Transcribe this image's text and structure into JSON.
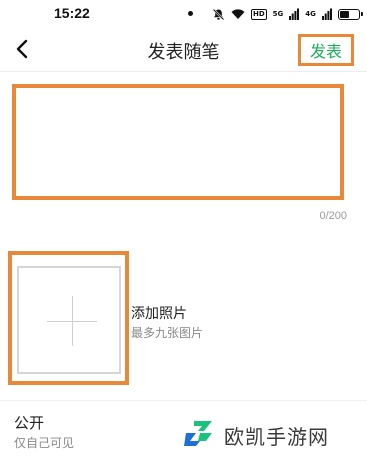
{
  "status_bar": {
    "time": "15:22",
    "hd_label": "HD",
    "signal_label_1": "5G",
    "signal_label_2": "4G"
  },
  "nav": {
    "title": "发表随笔",
    "publish_label": "发表"
  },
  "editor": {
    "text_value": "",
    "placeholder": "",
    "counter": "0/200"
  },
  "photo": {
    "add_label": "添加照片",
    "hint": "最多九张图片"
  },
  "privacy": {
    "title": "公开",
    "subtitle": "仅自己可见"
  },
  "watermark": {
    "text": "欧凯手游网"
  },
  "colors": {
    "highlight": "#e8893a",
    "accent_green": "#1aad5a",
    "watermark_green": "#19c37d",
    "watermark_blue": "#1f6fd6"
  }
}
